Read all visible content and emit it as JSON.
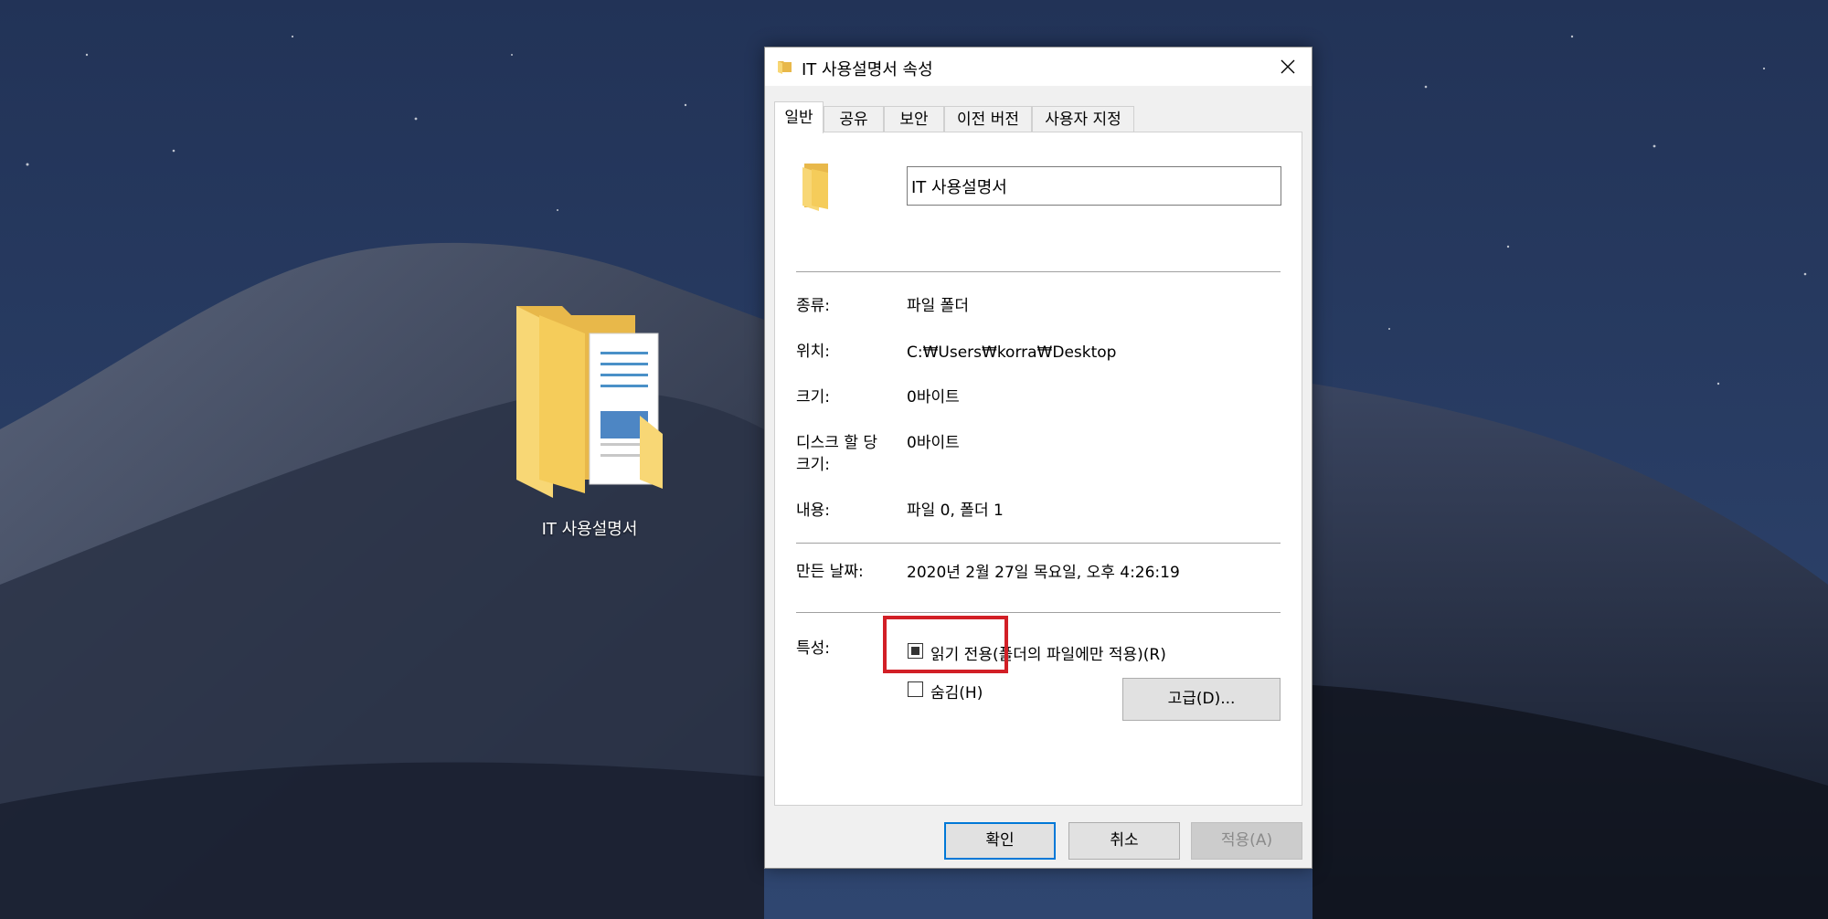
{
  "desktop": {
    "icon_label": "IT 사용설명서"
  },
  "dialog": {
    "title": "IT 사용설명서 속성",
    "tabs": [
      {
        "label": "일반",
        "active": true
      },
      {
        "label": "공유",
        "active": false
      },
      {
        "label": "보안",
        "active": false
      },
      {
        "label": "이전 버전",
        "active": false
      },
      {
        "label": "사용자 지정",
        "active": false
      }
    ],
    "name_value": "IT 사용설명서",
    "rows": {
      "type_label": "종류:",
      "type_value": "파일 폴더",
      "location_label": "위치:",
      "location_value": "C:₩Users₩korra₩Desktop",
      "size_label": "크기:",
      "size_value": "0바이트",
      "disk_label": "디스크 할 당 크기:",
      "disk_value": "0바이트",
      "contents_label": "내용:",
      "contents_value": "파일 0, 폴더 1",
      "created_label": "만든 날짜:",
      "created_value": "2020년 2월 27일 목요일, 오후 4:26:19"
    },
    "attributes": {
      "label": "특성:",
      "readonly_label": "읽기 전용(폴더의 파일에만 적용)(R)",
      "readonly_state": "indeterminate",
      "hidden_label": "숨김(H)",
      "hidden_checked": false,
      "advanced_button": "고급(D)..."
    },
    "buttons": {
      "ok": "확인",
      "cancel": "취소",
      "apply": "적용(A)"
    }
  },
  "colors": {
    "highlight": "#d21f26",
    "primary_border": "#0078d7",
    "folder_yellow": "#f8d775"
  }
}
